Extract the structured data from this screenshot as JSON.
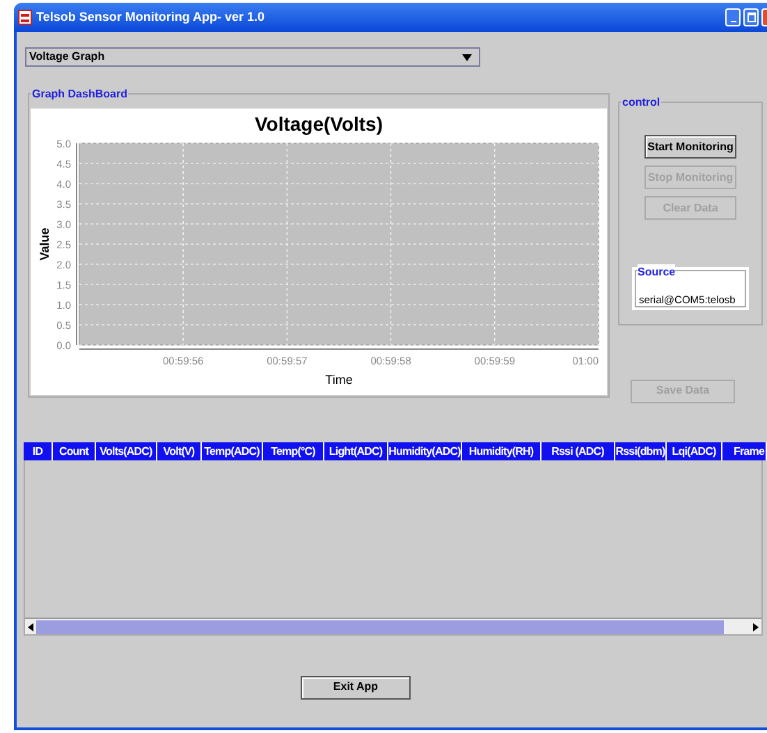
{
  "window": {
    "title": "Telsob Sensor Monitoring App- ver 1.0"
  },
  "view_select": {
    "value": "Voltage Graph"
  },
  "graph_dashboard": {
    "title": "Graph DashBoard",
    "chart_data": {
      "type": "line",
      "title": "Voltage(Volts)",
      "xlabel": "Time",
      "ylabel": "Value",
      "ylim": [
        0,
        5
      ],
      "grid": true,
      "categories": [
        null,
        "00:59:56",
        "00:59:57",
        "00:59:58",
        "00:59:59",
        "01:00"
      ],
      "yticks": [
        {
          "value": 0,
          "label": "0.0"
        },
        {
          "value": 0.5,
          "label": "0.5"
        },
        {
          "value": 1,
          "label": "1.0"
        },
        {
          "value": 1.5,
          "label": "1.5"
        },
        {
          "value": 2,
          "label": "2.0"
        },
        {
          "value": 2.5,
          "label": "2.5"
        },
        {
          "value": 3,
          "label": "3.0"
        },
        {
          "value": 3.5,
          "label": "3.5"
        },
        {
          "value": 4,
          "label": "4.0"
        },
        {
          "value": 4.5,
          "label": "4.5"
        },
        {
          "value": 5,
          "label": "5.0"
        }
      ]
    }
  },
  "control": {
    "title": "control",
    "buttons": [
      {
        "label": "Start Monitoring",
        "disabled": false
      },
      {
        "label": "Stop Monitoring",
        "disabled": true
      },
      {
        "label": "Clear Data",
        "disabled": true
      }
    ],
    "source": {
      "title": "Source",
      "value": "serial@COM5:telosb"
    }
  },
  "save_button": {
    "label": "Save Data",
    "disabled": true
  },
  "table": {
    "columns": [
      "ID",
      "Count",
      "Volts(ADC)",
      "Volt(V)",
      "Temp(ADC)",
      "Temp(°C)",
      "Light(ADC)",
      "Humidity(ADC)",
      "Humidity(RH)",
      "Rssi (ADC)",
      "Rssi(dbm)",
      "Lqi(ADC)",
      "Frame"
    ]
  },
  "exit_button": {
    "label": "Exit App",
    "disabled": false
  }
}
